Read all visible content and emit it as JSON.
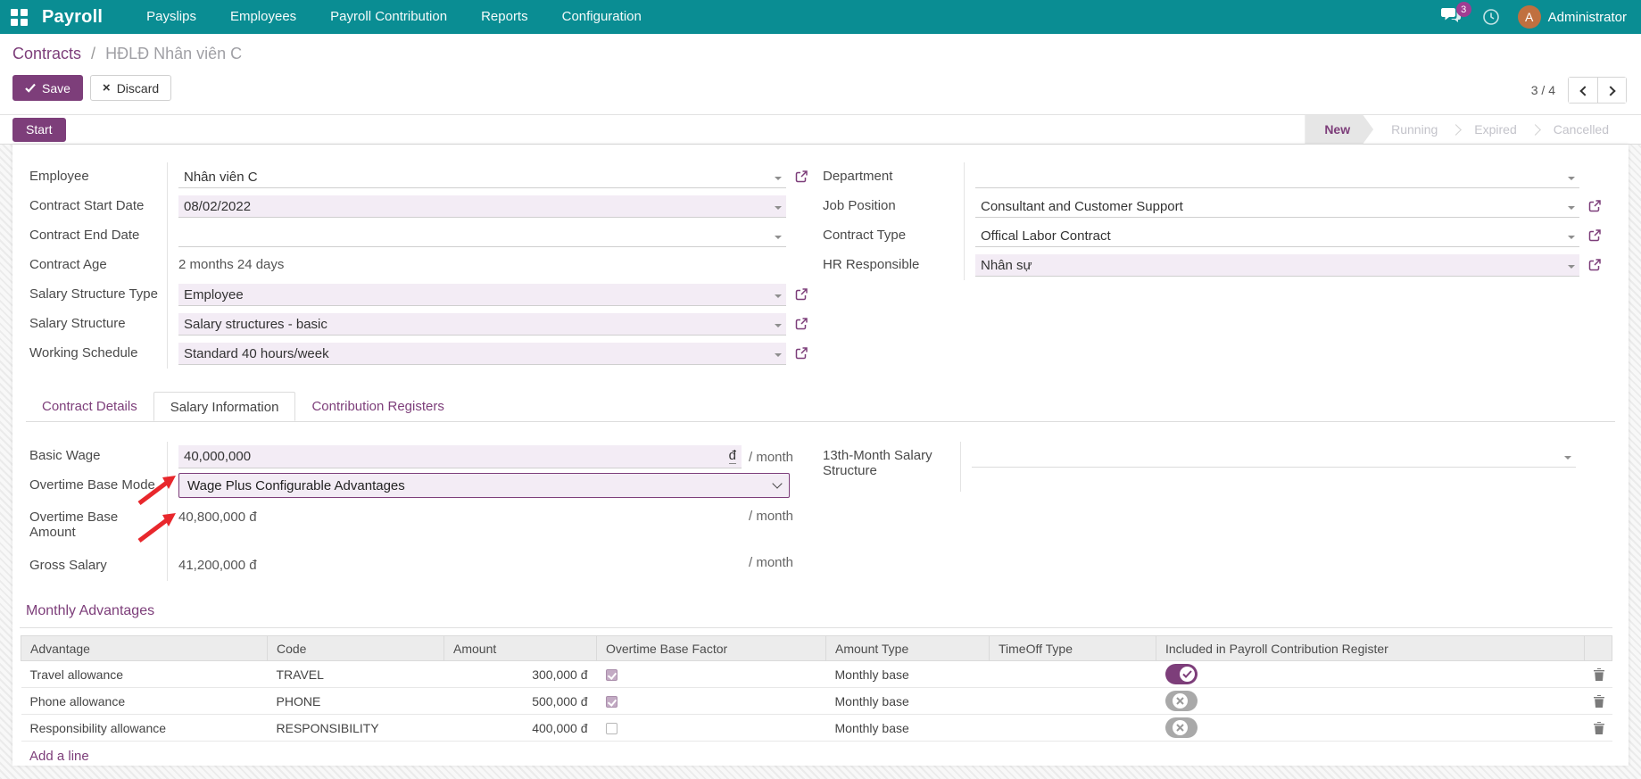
{
  "colors": {
    "accent": "#7d3e7a",
    "navbar_teal": "#0a8d93",
    "annotation_red": "#e8272c",
    "field_highlight": "#f3ecf5"
  },
  "nav": {
    "brand": "Payroll",
    "items": [
      "Payslips",
      "Employees",
      "Payroll Contribution",
      "Reports",
      "Configuration"
    ],
    "message_count": "3",
    "avatar_initial": "A",
    "user": "Administrator"
  },
  "breadcrumb": {
    "parent": "Contracts",
    "separator": "/",
    "current": "HĐLĐ Nhân viên C"
  },
  "actions": {
    "save": "Save",
    "discard": "Discard",
    "pager_count": "3 / 4"
  },
  "statusbar": {
    "start": "Start",
    "steps": [
      {
        "label": "New",
        "active": true
      },
      {
        "label": "Running",
        "active": false
      },
      {
        "label": "Expired",
        "active": false
      },
      {
        "label": "Cancelled",
        "active": false
      }
    ]
  },
  "fields": {
    "left": [
      {
        "label": "Employee",
        "value": "Nhân viên C"
      },
      {
        "label": "Contract Start Date",
        "value": "08/02/2022"
      },
      {
        "label": "Contract End Date",
        "value": ""
      },
      {
        "label": "Contract Age",
        "value": "2 months 24 days"
      },
      {
        "label": "Salary Structure Type",
        "value": "Employee"
      },
      {
        "label": "Salary Structure",
        "value": "Salary structures - basic"
      },
      {
        "label": "Working Schedule",
        "value": "Standard 40 hours/week"
      }
    ],
    "right": [
      {
        "label": "Department",
        "value": ""
      },
      {
        "label": "Job Position",
        "value": "Consultant and Customer Support"
      },
      {
        "label": "Contract Type",
        "value": "Offical Labor Contract"
      },
      {
        "label": "HR Responsible",
        "value": "Nhân sự"
      }
    ]
  },
  "tabs": [
    {
      "label": "Contract Details",
      "active": false
    },
    {
      "label": "Salary Information",
      "active": true
    },
    {
      "label": "Contribution Registers",
      "active": false
    }
  ],
  "salary": {
    "basic_wage": {
      "label": "Basic Wage",
      "value": "40,000,000",
      "currency": "đ"
    },
    "overtime_base_mode": {
      "label": "Overtime Base Mode",
      "value": "Wage Plus Configurable Advantages"
    },
    "overtime_base_amount": {
      "label": "Overtime Base Amount",
      "value": "40,800,000 đ"
    },
    "gross_salary": {
      "label": "Gross Salary",
      "value": "41,200,000 đ"
    },
    "thirteenth_month": {
      "label": "13th-Month Salary Structure",
      "value": ""
    },
    "per_month": "/ month"
  },
  "advantages": {
    "title": "Monthly Advantages",
    "headers": [
      "Advantage",
      "Code",
      "Amount",
      "Overtime Base Factor",
      "Amount Type",
      "TimeOff Type",
      "Included in Payroll Contribution Register"
    ],
    "rows": [
      {
        "advantage": "Travel allowance",
        "code": "TRAVEL",
        "amount": "300,000 đ",
        "overtime_base_factor": true,
        "amount_type": "Monthly base",
        "timeoff_type": "",
        "included": true
      },
      {
        "advantage": "Phone allowance",
        "code": "PHONE",
        "amount": "500,000 đ",
        "overtime_base_factor": true,
        "amount_type": "Monthly base",
        "timeoff_type": "",
        "included": false
      },
      {
        "advantage": "Responsibility allowance",
        "code": "RESPONSIBILITY",
        "amount": "400,000 đ",
        "overtime_base_factor": false,
        "amount_type": "Monthly base",
        "timeoff_type": "",
        "included": false
      }
    ],
    "add_line": "Add a line"
  }
}
